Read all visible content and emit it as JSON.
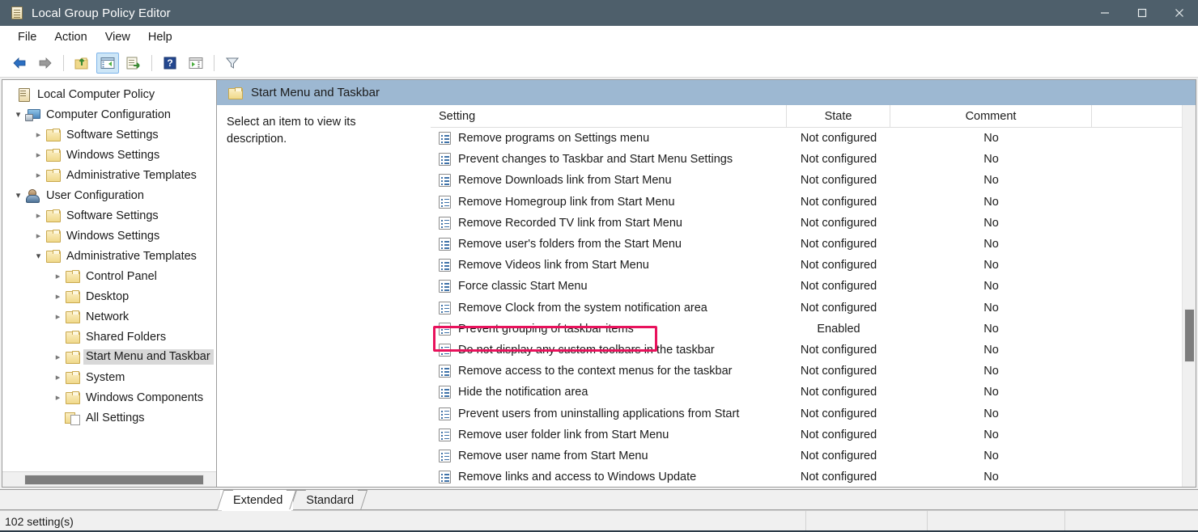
{
  "window": {
    "title": "Local Group Policy Editor",
    "icon": "policy-document-icon",
    "minimize": "—",
    "maximize": "□",
    "close": "✕"
  },
  "menubar": {
    "items": [
      {
        "label": "File"
      },
      {
        "label": "Action"
      },
      {
        "label": "View"
      },
      {
        "label": "Help"
      }
    ]
  },
  "toolbar": {
    "buttons": [
      {
        "name": "back-icon",
        "tooltip": "Back"
      },
      {
        "name": "forward-icon",
        "tooltip": "Forward"
      },
      {
        "name": "up-folder-icon",
        "tooltip": "Up one level"
      },
      {
        "name": "show-hide-console-tree-icon",
        "tooltip": "Show/Hide Console Tree",
        "active": true
      },
      {
        "name": "export-list-icon",
        "tooltip": "Export List"
      },
      {
        "name": "help-icon",
        "tooltip": "Help"
      },
      {
        "name": "show-action-pane-icon",
        "tooltip": "Show/Hide Action Pane"
      },
      {
        "name": "filter-icon",
        "tooltip": "Filter Options"
      }
    ]
  },
  "tree": {
    "items": [
      {
        "label": "Local Computer Policy",
        "indent": 0,
        "expander": "none",
        "icon": "policy-icon"
      },
      {
        "label": "Computer Configuration",
        "indent": 1,
        "expander": "open",
        "icon": "computer-icon"
      },
      {
        "label": "Software Settings",
        "indent": 2,
        "expander": "closed",
        "icon": "folder-icon"
      },
      {
        "label": "Windows Settings",
        "indent": 2,
        "expander": "closed",
        "icon": "folder-icon"
      },
      {
        "label": "Administrative Templates",
        "indent": 2,
        "expander": "closed",
        "icon": "folder-icon"
      },
      {
        "label": "User Configuration",
        "indent": 1,
        "expander": "open",
        "icon": "user-icon"
      },
      {
        "label": "Software Settings",
        "indent": 2,
        "expander": "closed",
        "icon": "folder-icon"
      },
      {
        "label": "Windows Settings",
        "indent": 2,
        "expander": "closed",
        "icon": "folder-icon"
      },
      {
        "label": "Administrative Templates",
        "indent": 2,
        "expander": "open",
        "icon": "folder-icon"
      },
      {
        "label": "Control Panel",
        "indent": 3,
        "expander": "closed",
        "icon": "folder-icon"
      },
      {
        "label": "Desktop",
        "indent": 3,
        "expander": "closed",
        "icon": "folder-icon"
      },
      {
        "label": "Network",
        "indent": 3,
        "expander": "closed",
        "icon": "folder-icon"
      },
      {
        "label": "Shared Folders",
        "indent": 3,
        "expander": "none",
        "icon": "folder-icon"
      },
      {
        "label": "Start Menu and Taskbar",
        "indent": 3,
        "expander": "closed",
        "icon": "folder-icon",
        "selected": true
      },
      {
        "label": "System",
        "indent": 3,
        "expander": "closed",
        "icon": "folder-icon"
      },
      {
        "label": "Windows Components",
        "indent": 3,
        "expander": "closed",
        "icon": "folder-icon"
      },
      {
        "label": "All Settings",
        "indent": 3,
        "expander": "none",
        "icon": "all-settings-icon"
      }
    ]
  },
  "content": {
    "header_title": "Start Menu and Taskbar",
    "description": "Select an item to view its description.",
    "columns": [
      {
        "label": "Setting"
      },
      {
        "label": "State"
      },
      {
        "label": "Comment"
      }
    ],
    "rows": [
      {
        "setting": "Remove programs on Settings menu",
        "state": "Not configured",
        "comment": "No"
      },
      {
        "setting": "Prevent changes to Taskbar and Start Menu Settings",
        "state": "Not configured",
        "comment": "No"
      },
      {
        "setting": "Remove Downloads link from Start Menu",
        "state": "Not configured",
        "comment": "No"
      },
      {
        "setting": "Remove Homegroup link from Start Menu",
        "state": "Not configured",
        "comment": "No"
      },
      {
        "setting": "Remove Recorded TV link from Start Menu",
        "state": "Not configured",
        "comment": "No"
      },
      {
        "setting": "Remove user's folders from the Start Menu",
        "state": "Not configured",
        "comment": "No"
      },
      {
        "setting": "Remove Videos link from Start Menu",
        "state": "Not configured",
        "comment": "No"
      },
      {
        "setting": "Force classic Start Menu",
        "state": "Not configured",
        "comment": "No"
      },
      {
        "setting": "Remove Clock from the system notification area",
        "state": "Not configured",
        "comment": "No"
      },
      {
        "setting": "Prevent grouping of taskbar items",
        "state": "Enabled",
        "comment": "No",
        "highlighted": true
      },
      {
        "setting": "Do not display any custom toolbars in the taskbar",
        "state": "Not configured",
        "comment": "No"
      },
      {
        "setting": "Remove access to the context menus for the taskbar",
        "state": "Not configured",
        "comment": "No"
      },
      {
        "setting": "Hide the notification area",
        "state": "Not configured",
        "comment": "No"
      },
      {
        "setting": "Prevent users from uninstalling applications from Start",
        "state": "Not configured",
        "comment": "No"
      },
      {
        "setting": "Remove user folder link from Start Menu",
        "state": "Not configured",
        "comment": "No"
      },
      {
        "setting": "Remove user name from Start Menu",
        "state": "Not configured",
        "comment": "No"
      },
      {
        "setting": "Remove links and access to Windows Update",
        "state": "Not configured",
        "comment": "No"
      }
    ]
  },
  "tabs": [
    {
      "label": "Extended",
      "active": true
    },
    {
      "label": "Standard",
      "active": false
    }
  ],
  "statusbar": {
    "text": "102 setting(s)"
  },
  "colors": {
    "titlebar": "#4e5f6b",
    "content_header": "#9db8d2",
    "highlight_box": "#e8125c",
    "tree_selection": "#d8d8d8",
    "toolbar_active": "#cde6f7"
  }
}
